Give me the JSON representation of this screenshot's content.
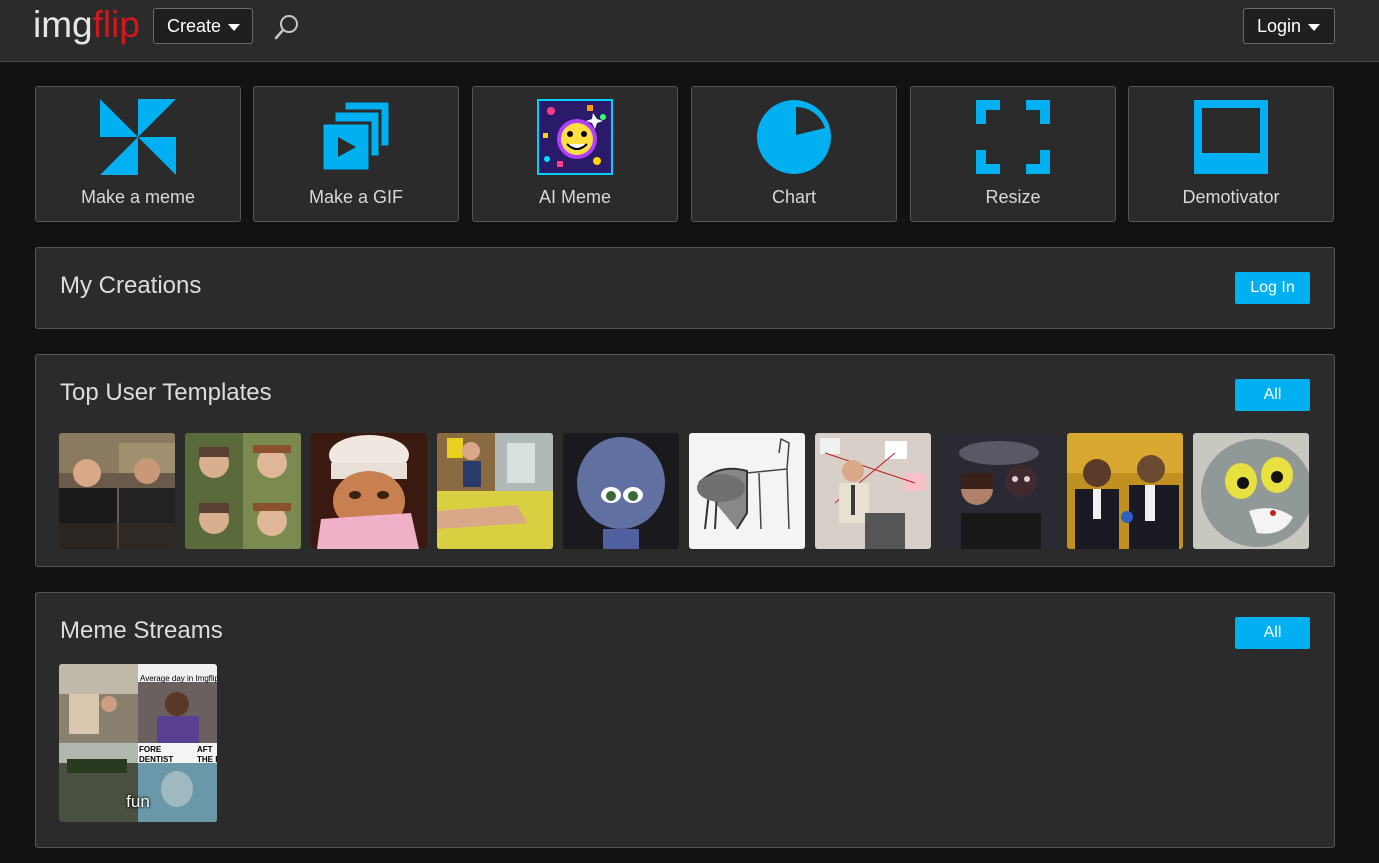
{
  "header": {
    "logo_img": "img",
    "logo_flip": "flip",
    "create_label": "Create",
    "login_label": "Login"
  },
  "tools": [
    {
      "label": "Make a meme",
      "icon": "pinwheel-icon"
    },
    {
      "label": "Make a GIF",
      "icon": "gif-stack-icon"
    },
    {
      "label": "AI Meme",
      "icon": "ai-meme-icon"
    },
    {
      "label": "Chart",
      "icon": "pie-chart-icon"
    },
    {
      "label": "Resize",
      "icon": "resize-corners-icon"
    },
    {
      "label": "Demotivator",
      "icon": "demotivator-frame-icon"
    }
  ],
  "my_creations": {
    "title": "My Creations",
    "login_button": "Log In"
  },
  "top_templates": {
    "title": "Top User Templates",
    "all_button": "All"
  },
  "meme_streams": {
    "title": "Meme Streams",
    "all_button": "All",
    "streams": [
      {
        "label": "fun",
        "caption_top": "Average day in Imgflip",
        "caption_left": "FORE DENTIST",
        "caption_right": "AFT THE DE"
      }
    ]
  },
  "colors": {
    "accent": "#00b0f0",
    "logo_red": "#d0181f",
    "panel_bg": "#2b2b2b",
    "page_bg": "#121212"
  }
}
